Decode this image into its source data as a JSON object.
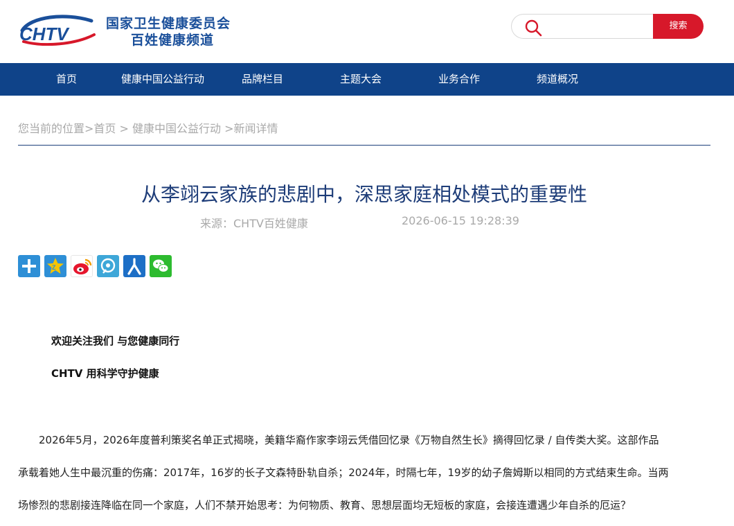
{
  "header": {
    "logo_text": "CHTV",
    "org_name": "国家卫生健康委员会",
    "channel_name": "百姓健康频道",
    "search": {
      "placeholder": "",
      "button_label": "搜索"
    }
  },
  "nav": {
    "items": [
      {
        "label": "首页"
      },
      {
        "label": "健康中国公益行动"
      },
      {
        "label": "品牌栏目"
      },
      {
        "label": "主题大会"
      },
      {
        "label": "业务合作"
      },
      {
        "label": "频道概况"
      }
    ]
  },
  "breadcrumb": {
    "prefix": "您当前的位置>",
    "home": "首页",
    "sep1": " > ",
    "section": "健康中国公益行动",
    "sep2": " >",
    "current": "新闻详情"
  },
  "article": {
    "title": "从李翊云家族的悲剧中，深思家庭相处模式的重要性",
    "source": "来源：CHTV百姓健康",
    "date": "2026-06-15 19:28:39",
    "lead1": "欢迎关注我们 与您健康同行",
    "lead2": "CHTV 用科学守护健康",
    "paragraph_lines": [
      "　　2026年5月，2026年度普利策奖名单正式揭晓，美籍华裔作家李翊云凭借回忆录《万物自然生长》摘得回忆录 / 自传类大奖。这部作品",
      "承载着她人生中最沉重的伤痛：2017年，16岁的长子文森特卧轨自杀；2024年，时隔七年，19岁的幼子詹姆斯以相同的方式结束生命。当两",
      "场惨烈的悲剧接连降临在同一个家庭，人们不禁开始思考：为何物质、教育、思想层面均无短板的家庭，会接连遭遇少年自杀的厄运？"
    ]
  },
  "share": {
    "buttons": [
      {
        "icon": "plus-share-icon"
      },
      {
        "icon": "qzone-icon"
      },
      {
        "icon": "weibo-icon"
      },
      {
        "icon": "tencent-weibo-icon"
      },
      {
        "icon": "renren-icon"
      },
      {
        "icon": "wechat-icon"
      }
    ]
  },
  "colors": {
    "brand_blue": "#0f4389",
    "title_blue": "#1d3c78",
    "search_red": "#d7182a",
    "muted_gray": "#a9a9a9"
  }
}
